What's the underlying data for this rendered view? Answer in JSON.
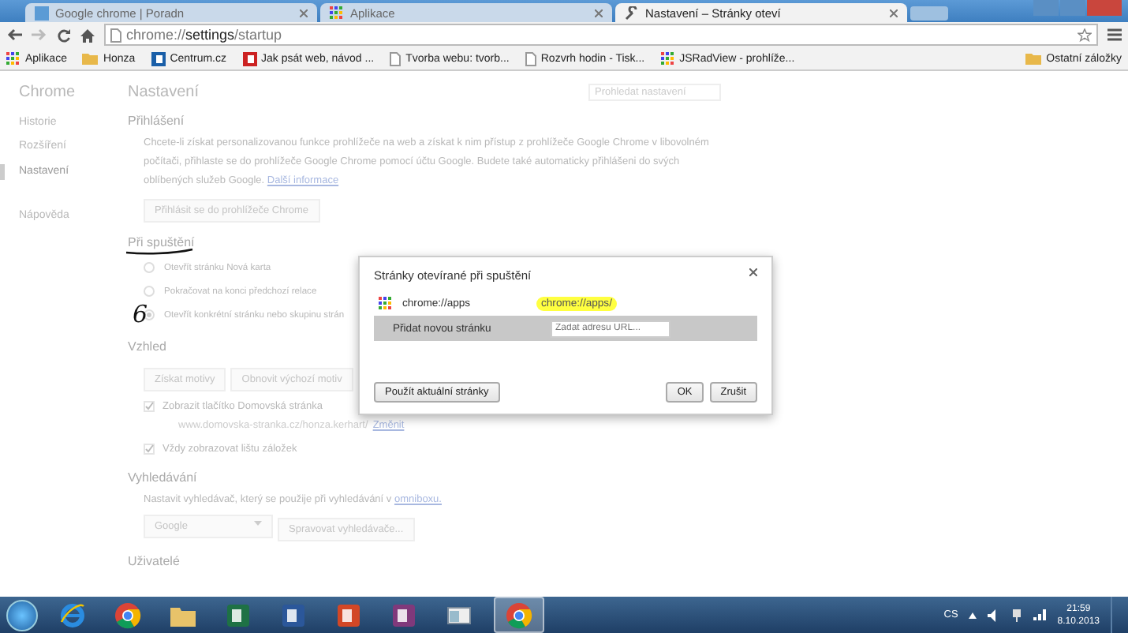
{
  "window": {
    "tabs": [
      {
        "title": "Google chrome | Poradn",
        "kind": "page",
        "selected": false
      },
      {
        "title": "Aplikace",
        "kind": "apps",
        "selected": false
      },
      {
        "title": "Nastavení – Stránky oteví",
        "kind": "settings",
        "selected": true
      }
    ]
  },
  "toolbar": {
    "url": "chrome://**settings**/startup"
  },
  "bookmarks": [
    {
      "label": "Aplikace",
      "kind": "apps"
    },
    {
      "label": "Honza",
      "kind": "folder"
    },
    {
      "label": "Centrum.cz",
      "kind": "site"
    },
    {
      "label": "Jak psát web, návod ...",
      "kind": "site2"
    },
    {
      "label": "Tvorba webu: tvorb...",
      "kind": "page"
    },
    {
      "label": "Rozvrh hodin - Tisk...",
      "kind": "page"
    },
    {
      "label": "JSRadView - prohlíže...",
      "kind": "apps"
    }
  ],
  "other_bookmarks": "Ostatní záložky",
  "sidebar": {
    "title": "Chrome",
    "items": [
      {
        "label": "Historie",
        "selected": false
      },
      {
        "label": "Rozšíření",
        "selected": false
      },
      {
        "label": "Nastavení",
        "selected": true
      },
      {
        "label": "Nápověda",
        "selected": false
      }
    ]
  },
  "settings": {
    "title": "Nastavení",
    "search": {
      "placeholder": "Prohledat nastavení"
    },
    "signin": {
      "heading": "Přihlášení",
      "text": "Chcete-li získat personalizovanou funkce prohlížeče na web a získat k nim přístup z prohlížeče Google Chrome v libovolném počítači, přihlaste se do prohlížeče Google Chrome pomocí účtu Google. Budete také automaticky přihlášeni do svých oblíbených služeb Google.",
      "link": "Další informace",
      "button": "Přihlásit se do prohlížeče Chrome"
    },
    "startup": {
      "heading": "Při spuštění",
      "annotation": "6",
      "options": [
        {
          "label": "Otevřít stránku Nová karta",
          "selected": false
        },
        {
          "label": "Pokračovat na konci předchozí relace",
          "selected": false
        },
        {
          "label": "Otevřít konkrétní stránku nebo skupinu strán",
          "selected": true
        }
      ]
    },
    "appearance": {
      "heading": "Vzhled",
      "buttons": [
        "Získat motivy",
        "Obnovit výchozí motiv"
      ],
      "home_button": {
        "label": "Zobrazit tlačítko Domovská stránka",
        "checked": true
      },
      "home_url": "www.domovska-stranka.cz/honza.kerhart/",
      "change_link": "Změnit",
      "bookmarks_bar": {
        "label": "Vždy zobrazovat lištu záložek",
        "checked": true
      }
    },
    "search_section": {
      "heading": "Vyhledávání",
      "text": "Nastavit vyhledávač, který se použije při vyhledávání v",
      "link": "omniboxu.",
      "engine": "Google",
      "manage_button": "Spravovat vyhledávače..."
    },
    "users": {
      "heading": "Uživatelé"
    }
  },
  "dialog": {
    "title": "Stránky otevírané při spuštění",
    "pages": [
      {
        "title": "chrome://apps",
        "url": "chrome://apps/"
      }
    ],
    "add_label": "Přidat novou stránku",
    "add_placeholder": "Zadat adresu URL...",
    "use_current": "Použít aktuální stránky",
    "ok": "OK",
    "cancel": "Zrušit"
  },
  "taskbar": {
    "apps": [
      {
        "kind": "ie",
        "active": false
      },
      {
        "kind": "chrome",
        "active": false
      },
      {
        "kind": "explorer",
        "active": false
      },
      {
        "kind": "excel",
        "active": false
      },
      {
        "kind": "word",
        "active": false
      },
      {
        "kind": "powerpoint",
        "active": false
      },
      {
        "kind": "onenote",
        "active": false
      },
      {
        "kind": "window",
        "active": false
      },
      {
        "kind": "chrome",
        "active": true
      }
    ],
    "language": "CS",
    "time": "21:59",
    "date": "8.10.2013"
  }
}
